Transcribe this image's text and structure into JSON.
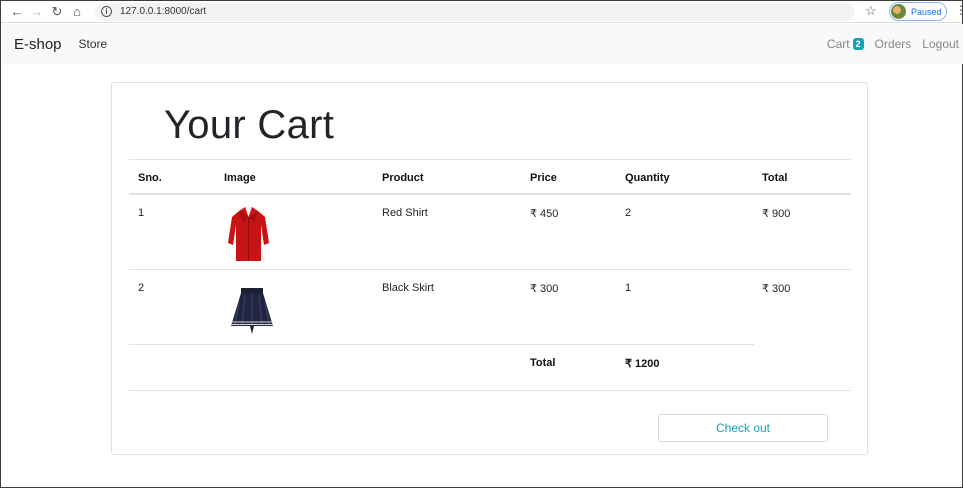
{
  "browser": {
    "url": "127.0.0.1:8000/cart",
    "profile_status": "Paused"
  },
  "navbar": {
    "brand": "E-shop",
    "store": "Store",
    "cart": "Cart",
    "cart_count": "2",
    "orders": "Orders",
    "logout": "Logout"
  },
  "cart": {
    "title": "Your Cart",
    "columns": [
      "Sno.",
      "Image",
      "Product",
      "Price",
      "Quantity",
      "Total"
    ],
    "items": [
      {
        "sno": "1",
        "product": "Red Shirt",
        "price": "₹ 450",
        "quantity": "2",
        "total": "₹ 900"
      },
      {
        "sno": "2",
        "product": "Black Skirt",
        "price": "₹ 300",
        "quantity": "1",
        "total": "₹ 300"
      }
    ],
    "total_label": "Total",
    "grand_total": "₹ 1200",
    "checkout_label": "Check out"
  },
  "colors": {
    "accent": "#17a2b8",
    "navbar_bg": "#f8f9fa"
  },
  "icons": [
    "back-icon",
    "forward-icon",
    "reload-icon",
    "home-icon",
    "info-icon",
    "star-icon",
    "menu-icon"
  ]
}
